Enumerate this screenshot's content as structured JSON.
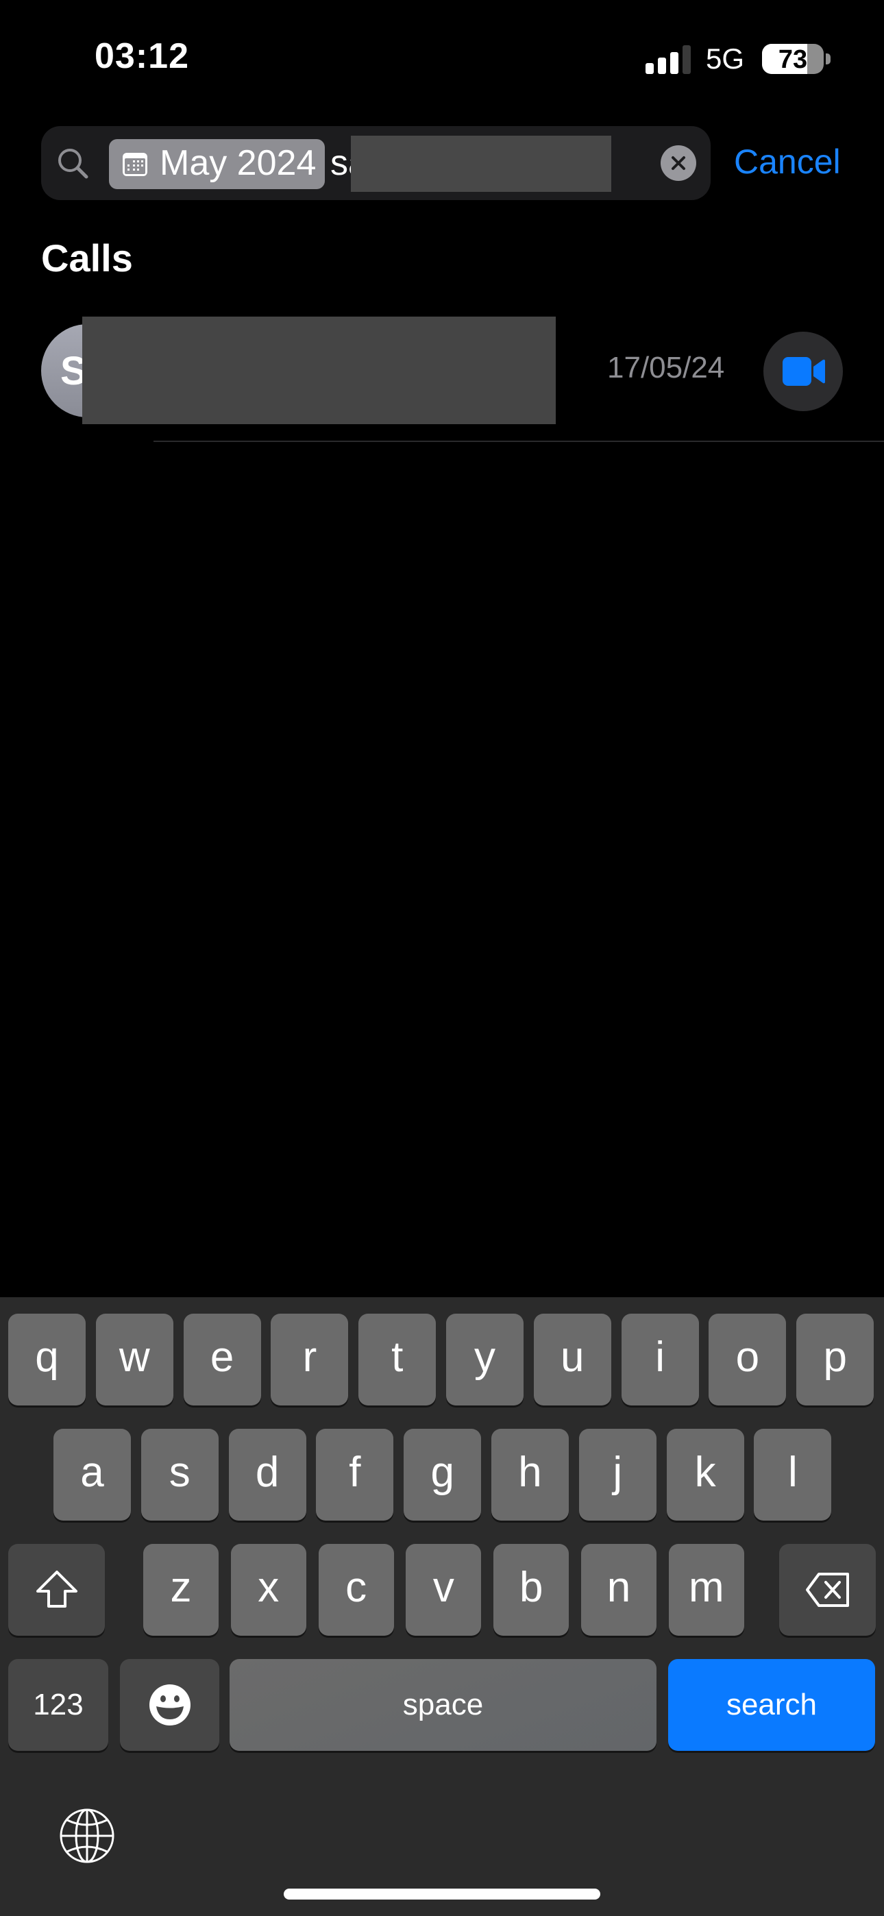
{
  "status_bar": {
    "time": "03:12",
    "signal_bars_active": 3,
    "signal_bars_total": 4,
    "network": "5G",
    "battery_percent": 73
  },
  "search": {
    "token_label": "May 2024",
    "token_icon": "calendar-icon",
    "query_visible_text": "sa",
    "query_redacted": true,
    "clear_icon": "clear-icon",
    "cancel_label": "Cancel"
  },
  "section": {
    "title": "Calls"
  },
  "calls": [
    {
      "avatar_initial": "S",
      "name_redacted": true,
      "date": "17/05/24",
      "action_icon": "video-camera-icon"
    }
  ],
  "keyboard": {
    "row1": [
      "q",
      "w",
      "e",
      "r",
      "t",
      "y",
      "u",
      "i",
      "o",
      "p"
    ],
    "row2": [
      "a",
      "s",
      "d",
      "f",
      "g",
      "h",
      "j",
      "k",
      "l"
    ],
    "row3": [
      "z",
      "x",
      "c",
      "v",
      "b",
      "n",
      "m"
    ],
    "shift_icon": "shift-icon",
    "delete_icon": "delete-icon",
    "numbers_label": "123",
    "emoji_icon": "emoji-icon",
    "space_label": "space",
    "return_label": "search",
    "globe_icon": "globe-icon"
  },
  "colors": {
    "accent": "#0a7aff",
    "link": "#1a84ff",
    "secondary_text": "#8e8e93"
  }
}
